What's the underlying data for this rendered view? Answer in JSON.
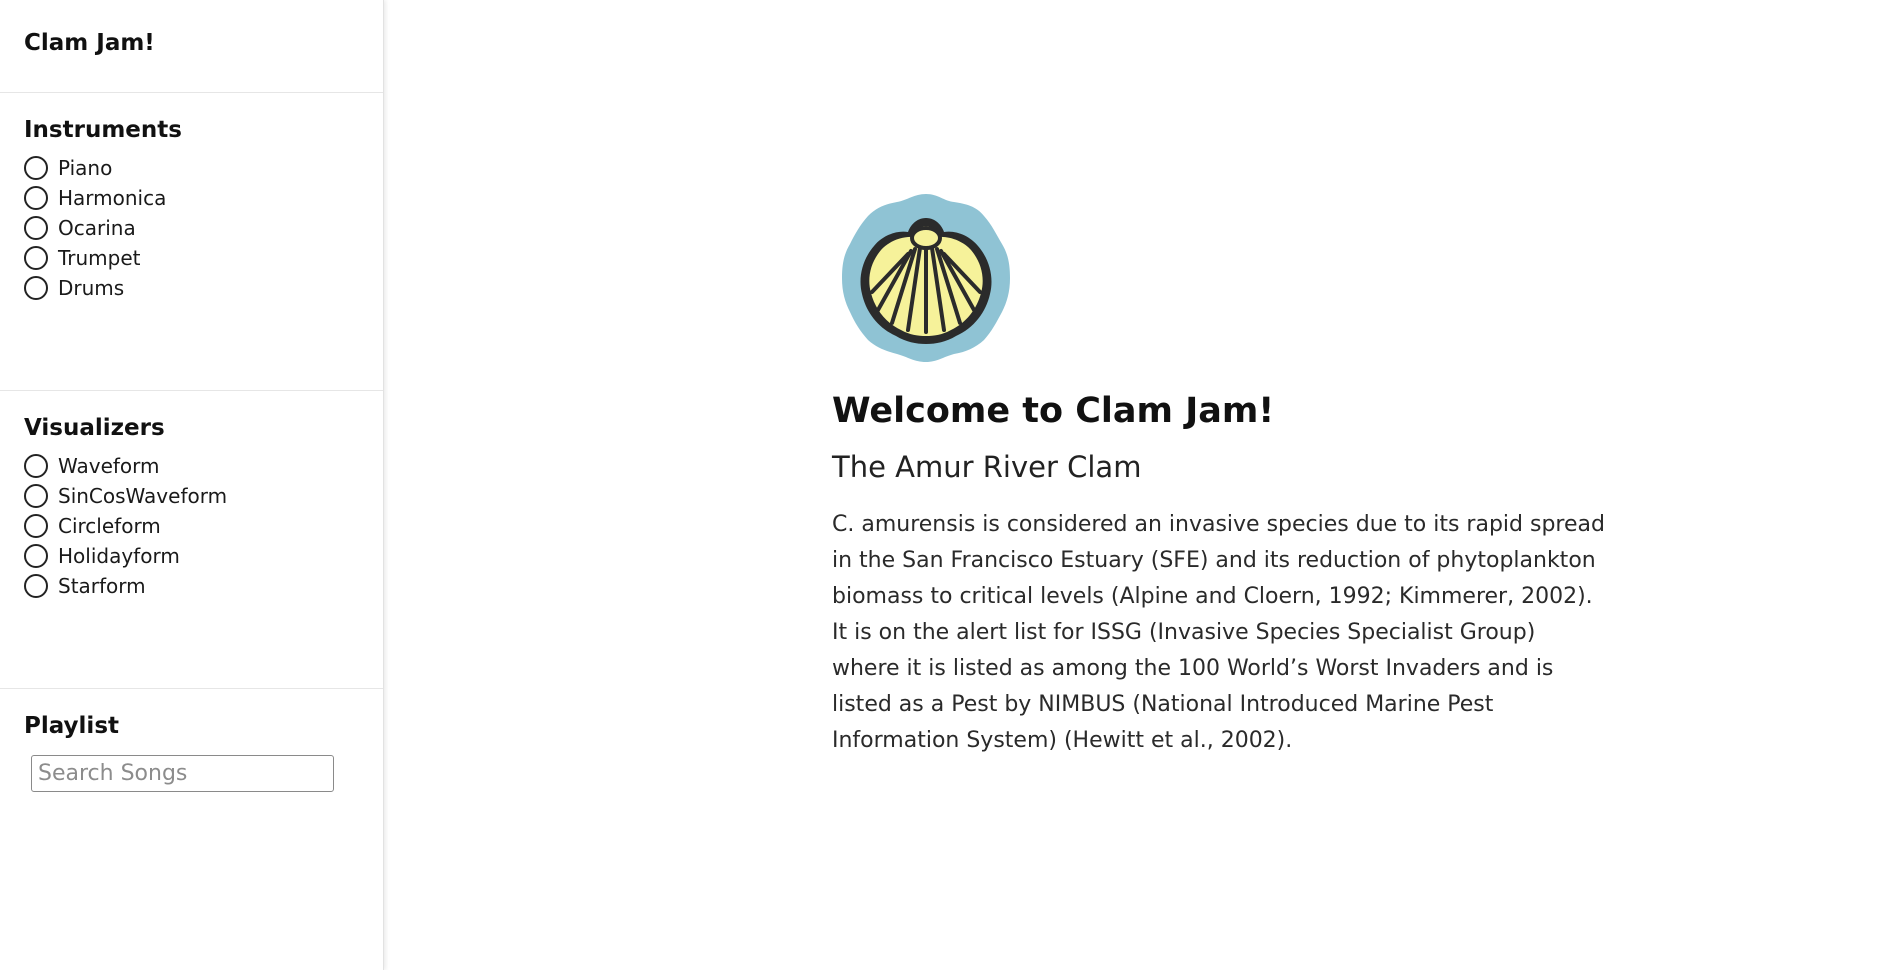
{
  "app": {
    "title": "Clam Jam!"
  },
  "sidebar": {
    "instruments": {
      "title": "Instruments",
      "items": [
        {
          "label": "Piano",
          "selected": false
        },
        {
          "label": "Harmonica",
          "selected": false
        },
        {
          "label": "Ocarina",
          "selected": false
        },
        {
          "label": "Trumpet",
          "selected": false
        },
        {
          "label": "Drums",
          "selected": false
        }
      ]
    },
    "visualizers": {
      "title": "Visualizers",
      "items": [
        {
          "label": "Waveform",
          "selected": false
        },
        {
          "label": "SinCosWaveform",
          "selected": false
        },
        {
          "label": "Circleform",
          "selected": false
        },
        {
          "label": "Holidayform",
          "selected": false
        },
        {
          "label": "Starform",
          "selected": false
        }
      ]
    },
    "playlist": {
      "title": "Playlist",
      "search_placeholder": "Search Songs",
      "search_value": ""
    }
  },
  "main": {
    "logo": {
      "icon": "clam-shell-logo",
      "colors": {
        "background": "#8fc3d4",
        "shell_fill": "#f6f29a",
        "shell_outline": "#2b2b2b"
      }
    },
    "title": "Welcome to Clam Jam!",
    "subtitle": "The Amur River Clam",
    "body": "C. amurensis is considered an invasive species due to its rapid spread in the San Francisco Estuary (SFE) and its reduction of phytoplankton biomass to critical levels (Alpine and Cloern, 1992; Kimmerer, 2002). It is on the alert list for ISSG (Invasive Species Specialist Group) where it is listed as among the 100 World’s Worst Invaders and is listed as a Pest by NIMBUS (National Introduced Marine Pest Information System) (Hewitt et al., 2002)."
  }
}
